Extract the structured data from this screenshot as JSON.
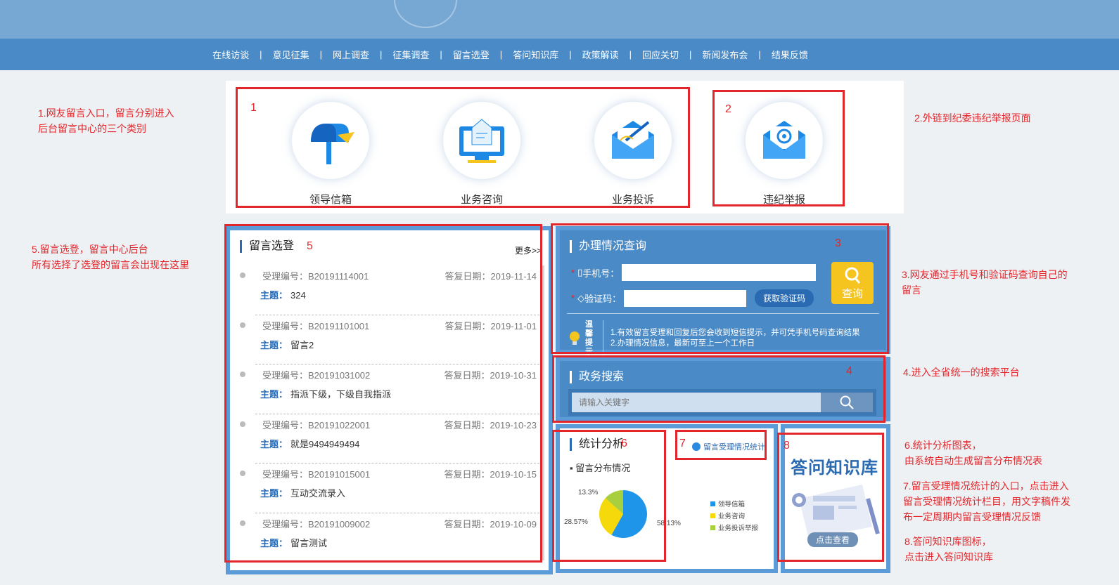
{
  "nav": [
    "在线访谈",
    "意见征集",
    "网上调查",
    "征集调查",
    "留言选登",
    "答问知识库",
    "政策解读",
    "回应关切",
    "新闻发布会",
    "结果反馈"
  ],
  "entries": [
    {
      "label": "领导信箱",
      "icon": "mailbox-icon"
    },
    {
      "label": "业务咨询",
      "icon": "monitor-letter-icon"
    },
    {
      "label": "业务投诉",
      "icon": "envelope-pen-icon"
    },
    {
      "label": "违纪举报",
      "icon": "at-envelope-icon"
    }
  ],
  "messages": {
    "title": "留言选登",
    "more": "更多>>",
    "items": [
      {
        "code": "受理编号：B20191114001",
        "date": "答复日期：2019-11-14",
        "subject_label": "主题：",
        "subject": "324"
      },
      {
        "code": "受理编号：B20191101001",
        "date": "答复日期：2019-11-01",
        "subject_label": "主题：",
        "subject": "留言2"
      },
      {
        "code": "受理编号：B20191031002",
        "date": "答复日期：2019-10-31",
        "subject_label": "主题：",
        "subject": "指派下级，下级自我指派"
      },
      {
        "code": "受理编号：B20191022001",
        "date": "答复日期：2019-10-23",
        "subject_label": "主题：",
        "subject": "就是9494949494"
      },
      {
        "code": "受理编号：B20191015001",
        "date": "答复日期：2019-10-15",
        "subject_label": "主题：",
        "subject": "互动交流录入"
      },
      {
        "code": "受理编号：B20191009002",
        "date": "答复日期：2019-10-09",
        "subject_label": "主题：",
        "subject": "留言测试"
      }
    ]
  },
  "query": {
    "title": "办理情况查询",
    "phone_label": "手机号：",
    "code_label": "验证码：",
    "get_code": "获取验证码",
    "submit": "查询",
    "tip_word": "温馨提示",
    "tip_lines": [
      "1.有效留言受理和回复后您会收到短信提示，并可凭手机号码查询结果",
      "2.办理情况信息，最新可至上一个工作日"
    ]
  },
  "search": {
    "title": "政务搜索",
    "placeholder": "请输入关键字"
  },
  "stats": {
    "title": "统计分析",
    "subtitle": "留言分布情况",
    "link": "留言受理情况统计"
  },
  "chart_data": {
    "type": "pie",
    "slices": [
      {
        "label": "领导信箱",
        "value": 58.13,
        "display": "58.13%",
        "color": "#1f95ea"
      },
      {
        "label": "业务咨询",
        "value": 28.57,
        "display": "28.57%",
        "color": "#f5d90a"
      },
      {
        "label": "业务投诉举报",
        "value": 13.3,
        "display": "13.3%",
        "color": "#a8cf3d"
      }
    ]
  },
  "kb": {
    "title": "答问知识库",
    "button": "点击查看"
  },
  "annotations": {
    "nums": [
      "1",
      "2",
      "3",
      "4",
      "5",
      "6",
      "7",
      "8"
    ],
    "notes": [
      "1.网友留言入口，留言分别进入\n后台留言中心的三个类别",
      "2.外链到纪委违纪举报页面",
      "5.留言选登，留言中心后台\n所有选择了选登的留言会出现在这里",
      "3.网友通过手机号和验证码查询自己的\n留言",
      "4.进入全省统一的搜索平台",
      "6.统计分析图表，\n由系统自动生成留言分布情况表",
      "7.留言受理情况统计的入口，点击进入\n留言受理情况统计栏目，用文字稿件发\n布一定周期内留言受理情况反馈",
      "8.答问知识库图标，\n点击进入答问知识库"
    ]
  }
}
